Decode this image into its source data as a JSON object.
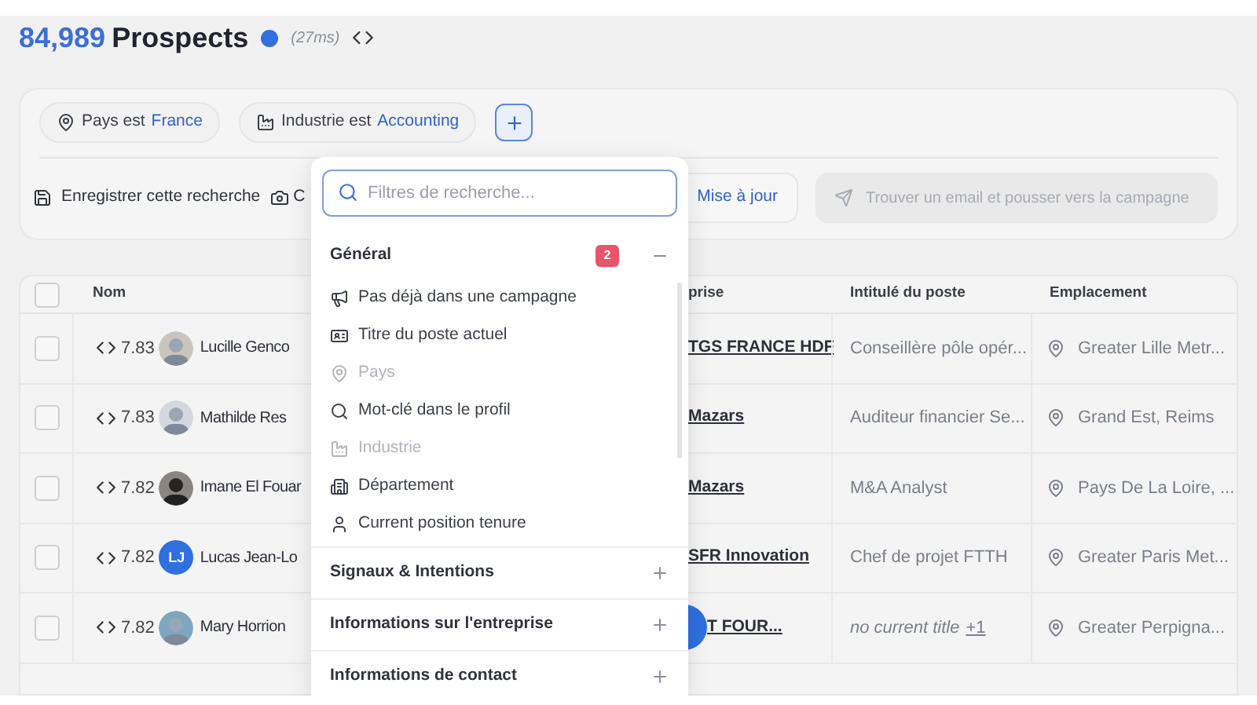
{
  "header": {
    "count": "84,989",
    "title": "Prospects",
    "timing": "(27ms)"
  },
  "filters": [
    {
      "field": "Pays est",
      "value": "France"
    },
    {
      "field": "Industrie est",
      "value": "Accounting"
    }
  ],
  "actions": {
    "save": "Enregistrer cette recherche",
    "second": "C",
    "update": "Mise à jour",
    "push": {
      "label": "Trouver un email et pousser vers la campagne",
      "disabled": true
    }
  },
  "table": {
    "columns": [
      "Nom",
      "prise",
      "Intitulé du poste",
      "Emplacement"
    ],
    "header_checked": false,
    "rows": [
      {
        "checked": false,
        "score": "7.83",
        "name": "Lucille Genco",
        "company": "TGS FRANCE HDF",
        "title": "Conseillère pôle opér...",
        "title_italic": false,
        "location": "Greater Lille Metr..."
      },
      {
        "checked": false,
        "score": "7.83",
        "name": "Mathilde Res",
        "company": "Mazars",
        "title": "Auditeur financier Se...",
        "title_italic": false,
        "location": "Grand Est, Reims"
      },
      {
        "checked": false,
        "score": "7.82",
        "name": "Imane El Fouar",
        "company": "Mazars",
        "title": "M&A Analyst",
        "title_italic": false,
        "location": "Pays De La Loire, ..."
      },
      {
        "checked": false,
        "score": "7.82",
        "initials": "LJ",
        "name": "Lucas Jean-Lo",
        "company": "SFR Innovation",
        "title": "Chef de projet FTTH",
        "title_italic": false,
        "location": "Greater Paris Met..."
      },
      {
        "checked": false,
        "score": "7.82",
        "name": "Mary Horrion",
        "company": "T FOUR...",
        "title": "no current title",
        "title_italic": true,
        "title_more": "+1",
        "location": "Greater Perpigna..."
      }
    ]
  },
  "dropdown": {
    "search": {
      "placeholder": "Filtres de recherche..."
    },
    "sections": [
      {
        "title": "Général",
        "badge": "2",
        "expanded": true,
        "items": [
          {
            "label": "Pas déjà dans une campagne",
            "disabled": false
          },
          {
            "label": "Titre du poste actuel",
            "disabled": false
          },
          {
            "label": "Pays",
            "disabled": true
          },
          {
            "label": "Mot-clé dans le profil",
            "disabled": false
          },
          {
            "label": "Industrie",
            "disabled": true
          },
          {
            "label": "Département",
            "disabled": false
          },
          {
            "label": "Current position tenure",
            "disabled": false
          }
        ]
      },
      {
        "title": "Signaux & Intentions",
        "expanded": false
      },
      {
        "title": "Informations sur l'entreprise",
        "expanded": false
      },
      {
        "title": "Informations de contact",
        "expanded": false
      }
    ]
  }
}
